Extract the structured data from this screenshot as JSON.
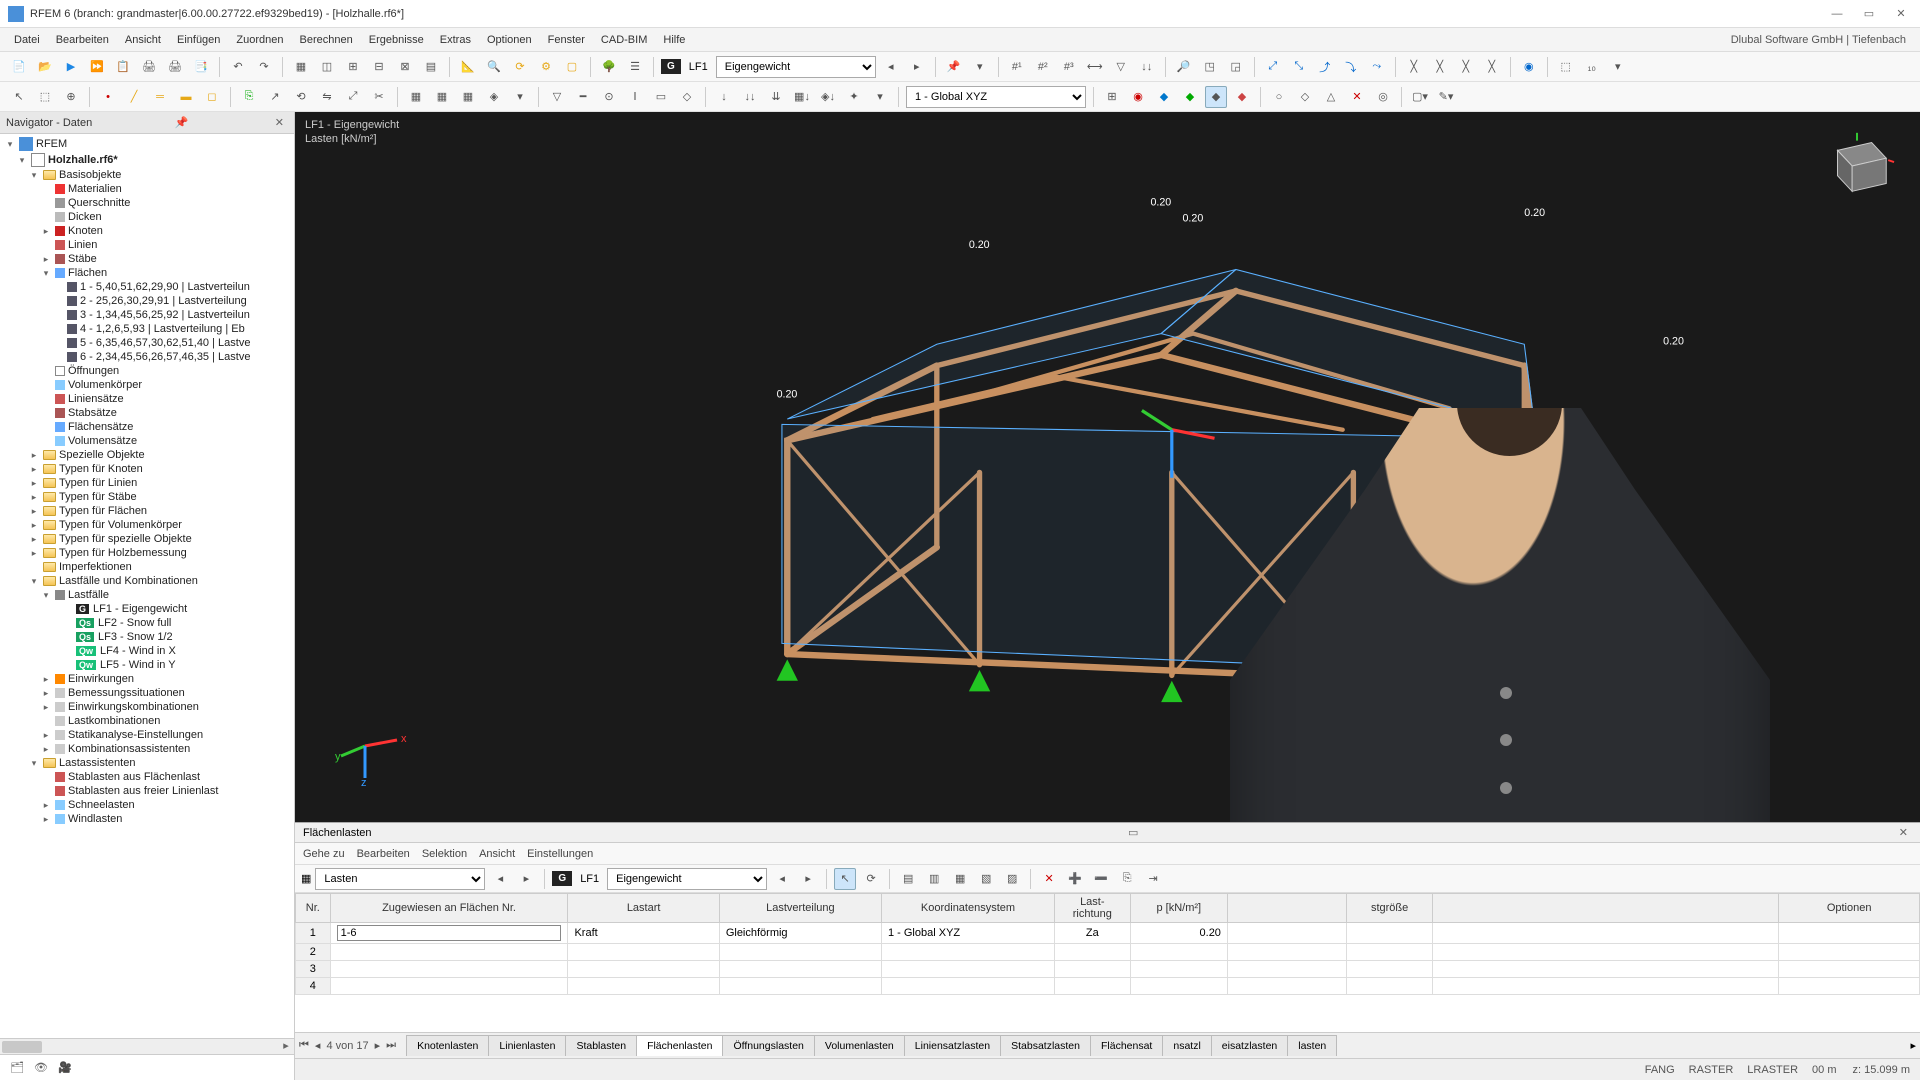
{
  "titlebar": {
    "title": "RFEM 6 (branch: grandmaster|6.00.00.27722.ef9329bed19) - [Holzhalle.rf6*]"
  },
  "menubar": {
    "items": [
      "Datei",
      "Bearbeiten",
      "Ansicht",
      "Einfügen",
      "Zuordnen",
      "Berechnen",
      "Ergebnisse",
      "Extras",
      "Optionen",
      "Fenster",
      "CAD-BIM",
      "Hilfe"
    ],
    "brand": "Dlubal Software GmbH | Tiefenbach"
  },
  "toolbar1": {
    "lf_badge": "G",
    "lf_code": "LF1",
    "lf_select": "Eigengewicht"
  },
  "toolbar2": {
    "coords_select": "1 - Global XYZ"
  },
  "navigator": {
    "header": "Navigator - Daten",
    "root_app": "RFEM",
    "root_model": "Holzhalle.rf6*",
    "groups": {
      "basisobjekte": "Basisobjekte",
      "materialien": "Materialien",
      "querschnitte": "Querschnitte",
      "dicken": "Dicken",
      "knoten": "Knoten",
      "linien": "Linien",
      "staebe": "Stäbe",
      "flaechen": "Flächen",
      "flaechen_items": [
        "1 - 5,40,51,62,29,90 | Lastverteilun",
        "2 - 25,26,30,29,91 | Lastverteilung",
        "3 - 1,34,45,56,25,92 | Lastverteilun",
        "4 - 1,2,6,5,93 | Lastverteilung | Eb",
        "5 - 6,35,46,57,30,62,51,40 | Lastve",
        "6 - 2,34,45,56,26,57,46,35 | Lastve"
      ],
      "oeffnungen": "Öffnungen",
      "volumenkoerper": "Volumenkörper",
      "liniensaetze": "Liniensätze",
      "stabsaetze": "Stabsätze",
      "flaechensaetze": "Flächensätze",
      "volumensaetze": "Volumensätze",
      "spezielle": "Spezielle Objekte",
      "typ_knoten": "Typen für Knoten",
      "typ_linien": "Typen für Linien",
      "typ_staebe": "Typen für Stäbe",
      "typ_flaechen": "Typen für Flächen",
      "typ_volumen": "Typen für Volumenkörper",
      "typ_spezielle": "Typen für spezielle Objekte",
      "typ_holz": "Typen für Holzbemessung",
      "imperfektionen": "Imperfektionen",
      "lastfaelle_kombos": "Lastfälle und Kombinationen",
      "lastfaelle": "Lastfälle",
      "lf_items": [
        {
          "badge": "G",
          "color": "#222",
          "label": "LF1 - Eigengewicht"
        },
        {
          "badge": "Qs",
          "color": "#18a060",
          "label": "LF2 - Snow full"
        },
        {
          "badge": "Qs",
          "color": "#18a060",
          "label": "LF3 - Snow 1/2"
        },
        {
          "badge": "Qw",
          "color": "#18c078",
          "label": "LF4 - Wind in X"
        },
        {
          "badge": "Qw",
          "color": "#18c078",
          "label": "LF5 - Wind in Y"
        }
      ],
      "einwirkungen": "Einwirkungen",
      "bemessung": "Bemessungssituationen",
      "einwirkungskombos": "Einwirkungskombinationen",
      "lastkombos": "Lastkombinationen",
      "statik": "Statikanalyse-Einstellungen",
      "kombo_assist": "Kombinationsassistenten",
      "lastassistenten": "Lastassistenten",
      "stablasten_fl": "Stablasten aus Flächenlast",
      "stablasten_li": "Stablasten aus freier Linienlast",
      "schneelasten": "Schneelasten",
      "windlasten": "Windlasten"
    }
  },
  "viewport": {
    "title_line1": "LF1 - Eigengewicht",
    "title_line2": "Lasten [kN/m²]",
    "labels": [
      "0.20",
      "0.20",
      "0.20",
      "0.20",
      "0.20",
      "0.20"
    ]
  },
  "table": {
    "title": "Flächenlasten",
    "menu": [
      "Gehe zu",
      "Bearbeiten",
      "Selektion",
      "Ansicht",
      "Einstellungen"
    ],
    "sel_group": "Lasten",
    "lf_badge": "G",
    "lf_code": "LF1",
    "lf_name": "Eigengewicht",
    "columns": [
      "Nr.",
      "Zugewiesen an Flächen Nr.",
      "Lastart",
      "Lastverteilung",
      "Koordinatensystem",
      "Last-\nrichtung",
      "p [kN/m²]",
      "",
      "",
      "stgröße",
      "",
      "Optionen"
    ],
    "rows": [
      {
        "nr": "1",
        "assign": "1-6",
        "art": "Kraft",
        "vert": "Gleichförmig",
        "coord": "1 - Global XYZ",
        "dir": "Za",
        "p": "0.20"
      },
      {
        "nr": "2"
      },
      {
        "nr": "3"
      },
      {
        "nr": "4"
      }
    ],
    "nav_text": "4 von 17",
    "tabs": [
      "Knotenlasten",
      "Linienlasten",
      "Stablasten",
      "Flächenlasten",
      "Öffnungslasten",
      "Volumenlasten",
      "Liniensatzlasten",
      "Stabsatzlasten",
      "Flächensat",
      "nsatzl",
      "eisatzlasten",
      "lasten"
    ],
    "active_tab": 3
  },
  "statusbar": {
    "items": [
      "FANG",
      "RASTER",
      "LRASTER"
    ],
    "coords": [
      "00 m",
      "z: 15.099 m"
    ]
  }
}
